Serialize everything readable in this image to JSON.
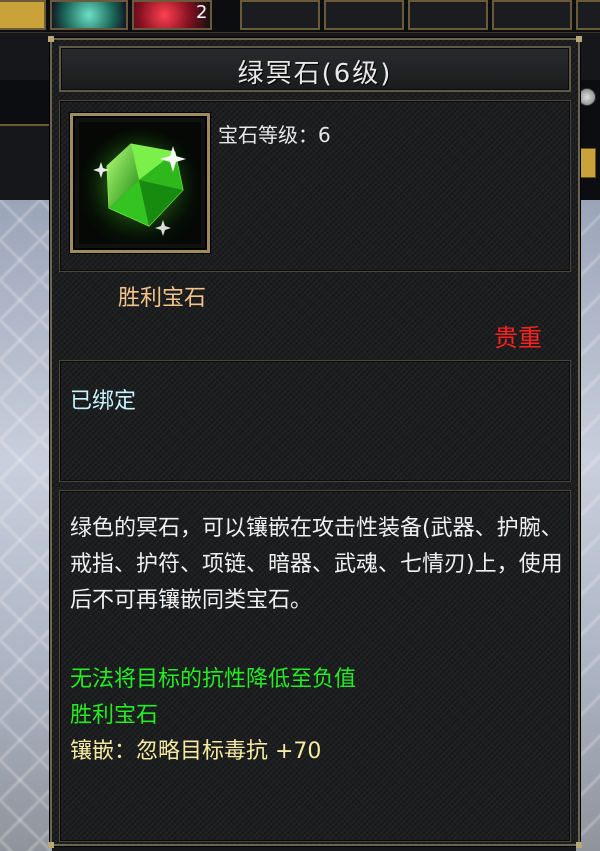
{
  "hotbar": {
    "stack_count": "2"
  },
  "tooltip": {
    "title": "绿冥石(6级)",
    "gem_level_label": "宝石等级：6",
    "gem_type": "胜利宝石",
    "rarity": "贵重",
    "bind_status": "已绑定",
    "description": "绿色的冥石，可以镶嵌在攻击性装备(武器、护腕、戒指、护符、项链、暗器、武魂、七情刃)上，使用后不可再镶嵌同类宝石。",
    "effect_line_1": "无法将目标的抗性降低至负值",
    "effect_line_2": "胜利宝石",
    "inlay_effect": "镶嵌：忽略目标毒抗 +70"
  },
  "colors": {
    "title": "#e8e8e8",
    "gem_type": "#f2c48a",
    "rarity": "#ff2020",
    "bind": "#c8f4ff",
    "effect": "#22ee22",
    "inlay": "#f4eaa0"
  },
  "icons": {
    "item": "green-gem-icon"
  }
}
